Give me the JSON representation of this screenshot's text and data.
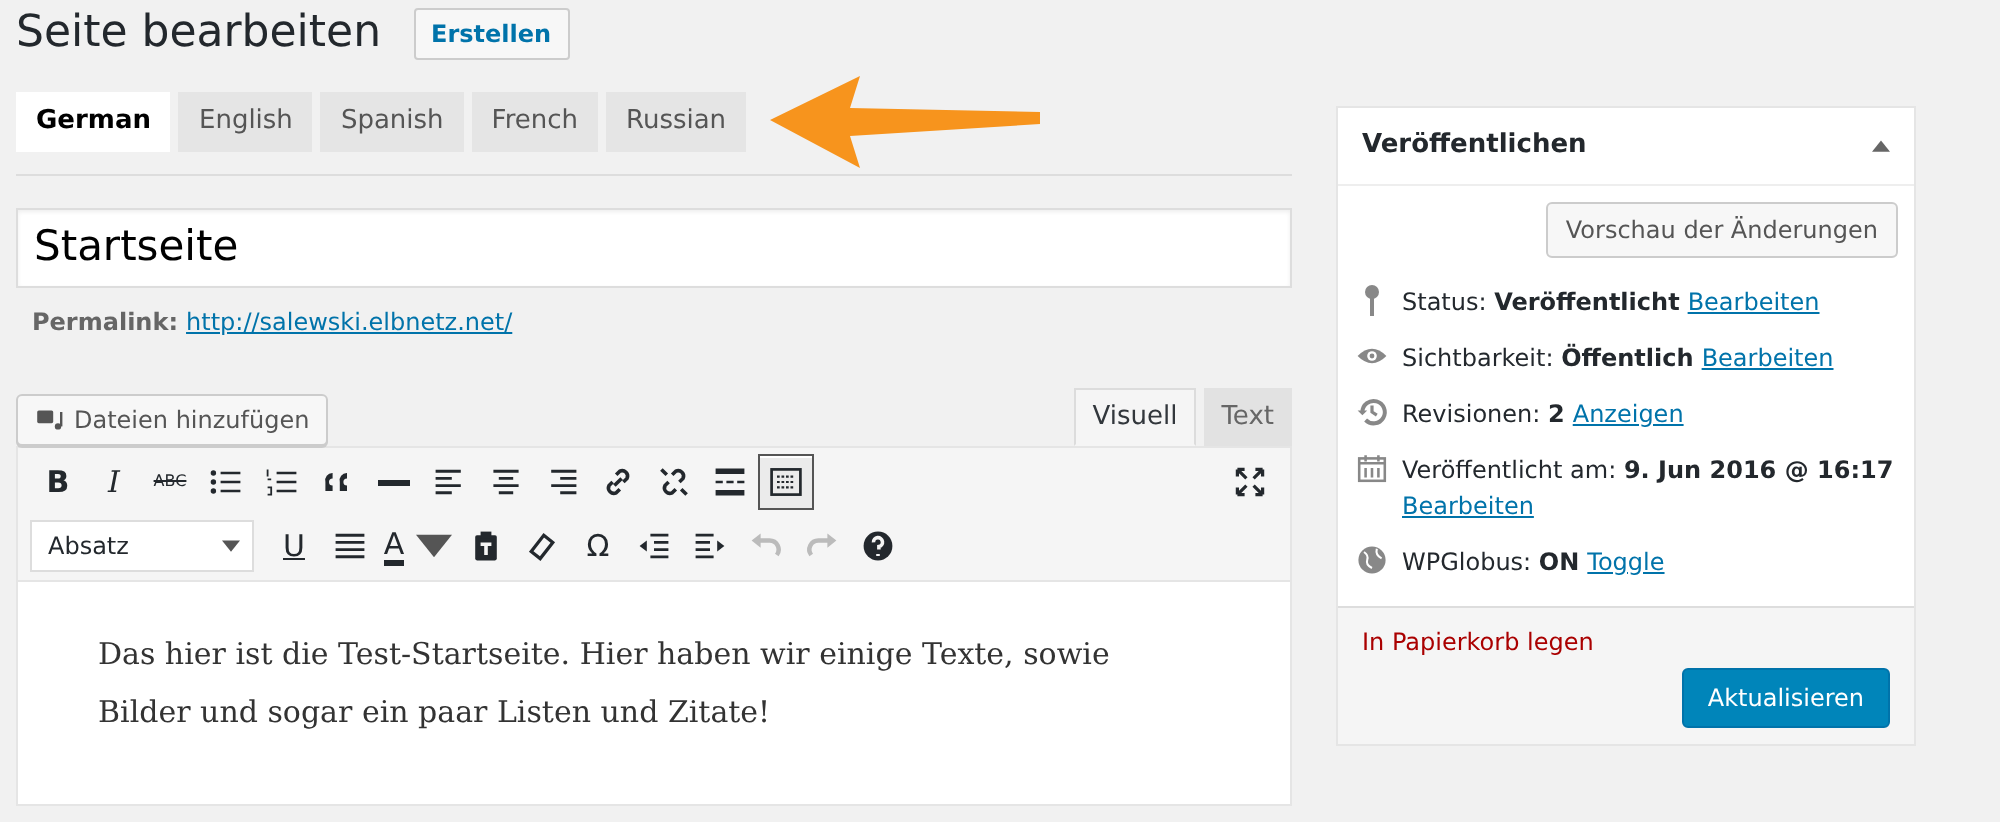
{
  "page_title": "Seite bearbeiten",
  "add_button": "Erstellen",
  "language_tabs": [
    {
      "label": "German",
      "selected": true
    },
    {
      "label": "English",
      "selected": false
    },
    {
      "label": "Spanish",
      "selected": false
    },
    {
      "label": "French",
      "selected": false
    },
    {
      "label": "Russian",
      "selected": false
    }
  ],
  "title_field": {
    "value": "Startseite"
  },
  "permalink": {
    "label": "Permalink:",
    "url": "http://salewski.elbnetz.net/"
  },
  "media_button": "Dateien hinzufügen",
  "editor_tabs": [
    {
      "label": "Visuell",
      "selected": true
    },
    {
      "label": "Text",
      "selected": false
    }
  ],
  "toolbar_row_1": [
    {
      "kind": "glyph",
      "label": "B",
      "pressed": false,
      "disabled": false
    },
    {
      "kind": "glyph",
      "label": "I",
      "pressed": false,
      "disabled": false
    },
    {
      "kind": "glyph",
      "label": "ABC",
      "pressed": false,
      "disabled": false
    },
    {
      "kind": "icon",
      "pressed": false,
      "disabled": false
    },
    {
      "kind": "icon",
      "pressed": false,
      "disabled": false
    },
    {
      "kind": "icon",
      "pressed": false,
      "disabled": false
    },
    {
      "kind": "icon",
      "pressed": false,
      "disabled": false
    },
    {
      "kind": "icon",
      "pressed": false,
      "disabled": false
    },
    {
      "kind": "icon",
      "pressed": false,
      "disabled": false
    },
    {
      "kind": "icon",
      "pressed": false,
      "disabled": false
    },
    {
      "kind": "icon",
      "pressed": false,
      "disabled": false
    },
    {
      "kind": "icon",
      "pressed": false,
      "disabled": false
    },
    {
      "kind": "icon",
      "pressed": false,
      "disabled": false
    },
    {
      "kind": "icon",
      "pressed": true,
      "disabled": false
    },
    {
      "kind": "icon",
      "pressed": false,
      "disabled": false
    }
  ],
  "format_select": {
    "value": "Absatz"
  },
  "toolbar_row_2": [
    {
      "kind": "glyph",
      "label": "U",
      "pressed": false,
      "disabled": false
    },
    {
      "kind": "icon",
      "pressed": false,
      "disabled": false
    },
    {
      "kind": "glyph",
      "label": "A",
      "pressed": false,
      "disabled": false
    },
    {
      "kind": "icon",
      "pressed": false,
      "disabled": false
    },
    {
      "kind": "icon",
      "pressed": false,
      "disabled": false
    },
    {
      "kind": "glyph",
      "label": "Ω",
      "pressed": false,
      "disabled": false
    },
    {
      "kind": "icon",
      "pressed": false,
      "disabled": false
    },
    {
      "kind": "icon",
      "pressed": false,
      "disabled": false
    },
    {
      "kind": "icon",
      "pressed": false,
      "disabled": true
    },
    {
      "kind": "icon",
      "pressed": false,
      "disabled": true
    },
    {
      "kind": "icon",
      "pressed": false,
      "disabled": false
    }
  ],
  "content": [
    "Das hier ist die Test-Startseite. Hier haben wir einige Texte, sowie Bilder und sogar ein paar Listen und Zitate!"
  ],
  "publish_box": {
    "title": "Veröffentlichen",
    "preview_button": "Vorschau der Änderungen",
    "rows": [
      {
        "text": "Status: **Veröffentlicht**",
        "link": "Bearbeiten"
      },
      {
        "text": "Sichtbarkeit: **Öffentlich**",
        "link": "Bearbeiten"
      },
      {
        "text": "Revisionen: **2**",
        "link": "Anzeigen"
      },
      {
        "text": "Veröffentlicht am: **9. Jun 2016 @ 16:17**",
        "link": "Bearbeiten"
      },
      {
        "text": "WPGlobus: **ON**",
        "link": "Toggle"
      }
    ],
    "trash_link": "In Papierkorb legen",
    "update_button": "Aktualisieren"
  }
}
